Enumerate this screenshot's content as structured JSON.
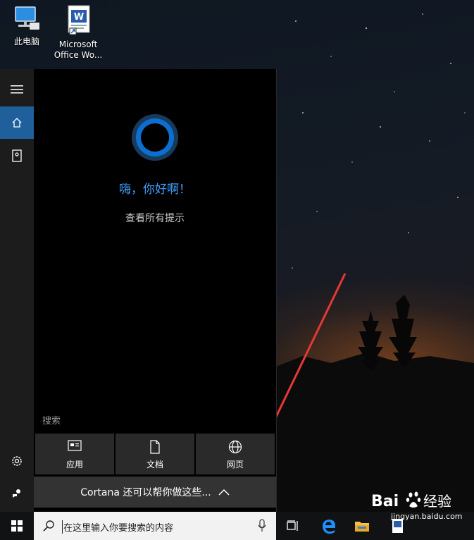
{
  "desktop": {
    "icons": [
      {
        "label": "此电脑",
        "icon": "computer-icon"
      },
      {
        "label": "Microsoft Office Wo...",
        "icon": "word-document-icon"
      }
    ]
  },
  "start_rail": {
    "items": [
      {
        "name": "hamburger-menu-icon"
      },
      {
        "name": "home-icon",
        "active": true
      },
      {
        "name": "notebook-icon"
      },
      {
        "name": "settings-icon"
      },
      {
        "name": "feedback-icon"
      }
    ]
  },
  "cortana": {
    "greeting": "嗨，你好啊！",
    "tips_link": "查看所有提示",
    "search_label": "搜索",
    "filters": [
      {
        "label": "应用",
        "icon": "apps-icon"
      },
      {
        "label": "文档",
        "icon": "document-icon"
      },
      {
        "label": "网页",
        "icon": "globe-icon"
      }
    ],
    "more_bar": "Cortana 还可以帮你做这些..."
  },
  "taskbar": {
    "search_placeholder": "在这里输入你要搜索的内容",
    "apps": [
      "task-view-icon",
      "edge-icon",
      "file-explorer-icon",
      "word-icon"
    ]
  },
  "watermark": {
    "brand": "Bai",
    "brand2": "经验",
    "site": "jingyan.baidu.com"
  },
  "colors": {
    "accent": "#1e5f9c",
    "cortana_blue": "#3ea0ff",
    "arrow": "#e53935"
  }
}
